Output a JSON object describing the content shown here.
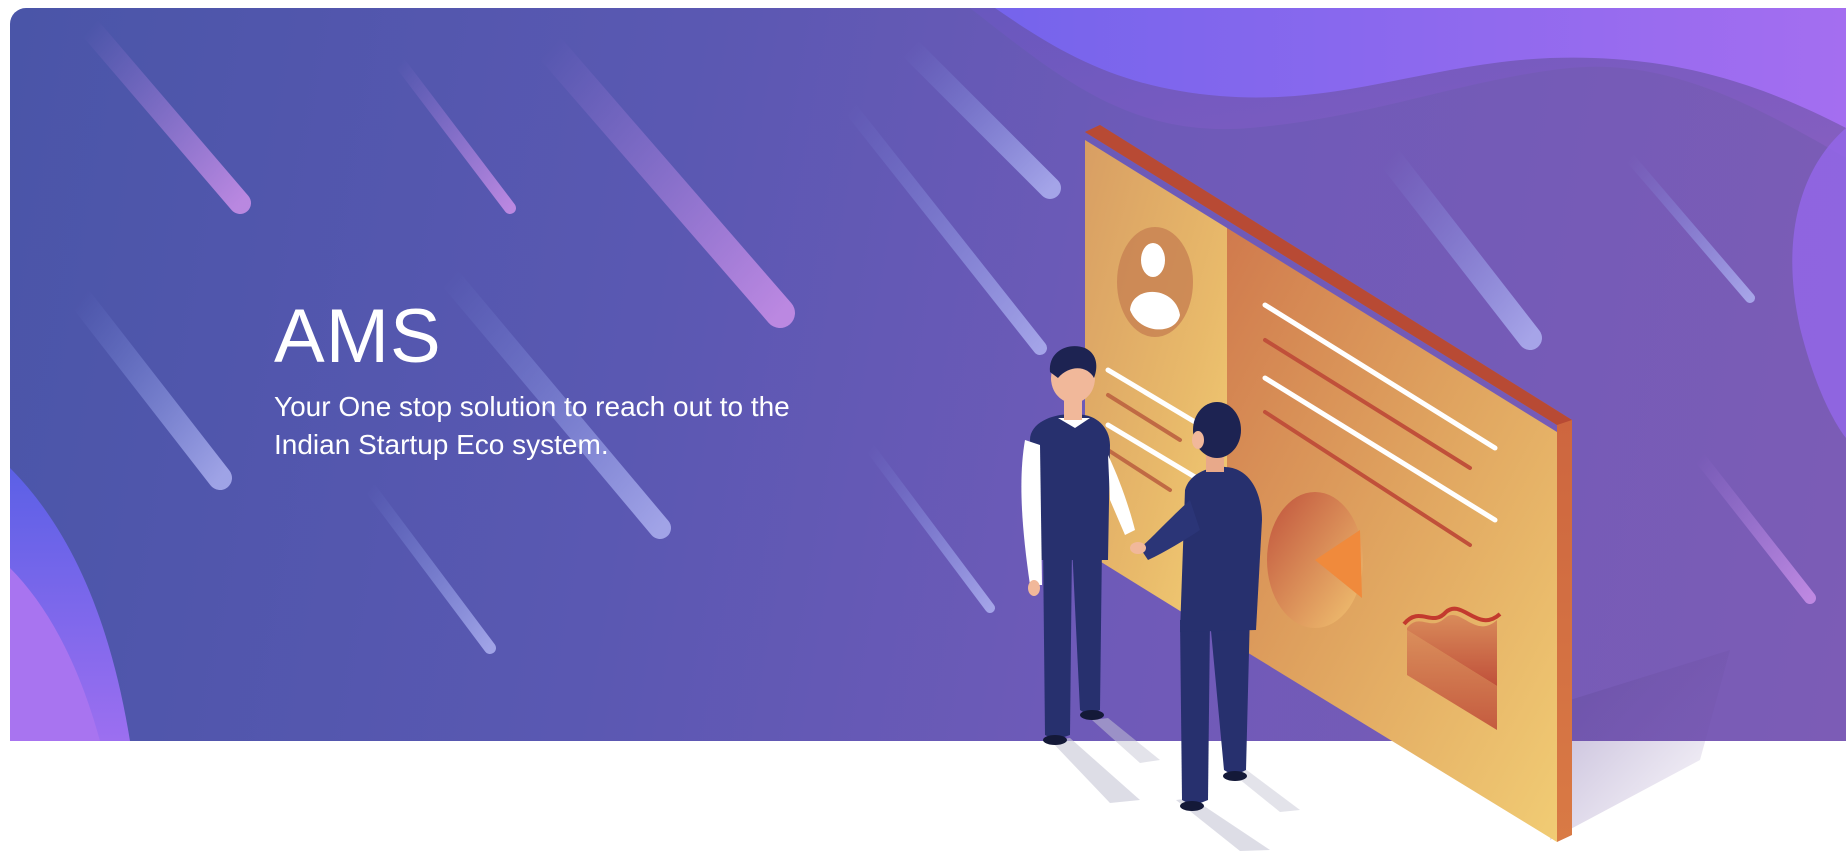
{
  "hero": {
    "title": "AMS",
    "subtitle": "Your One stop solution to reach out to the Indian Startup Eco system."
  },
  "colors": {
    "banner_start": "#4a55a8",
    "banner_end": "#7c5cb6",
    "wave_accent": "#8b6cf0",
    "board_face": "#e9b463",
    "board_edge": "#c55a3c",
    "suit": "#27306e",
    "text": "#ffffff"
  },
  "icons": {
    "profile": "user-avatar-icon",
    "chart": "pie-chart-icon",
    "graph": "area-chart-icon"
  }
}
